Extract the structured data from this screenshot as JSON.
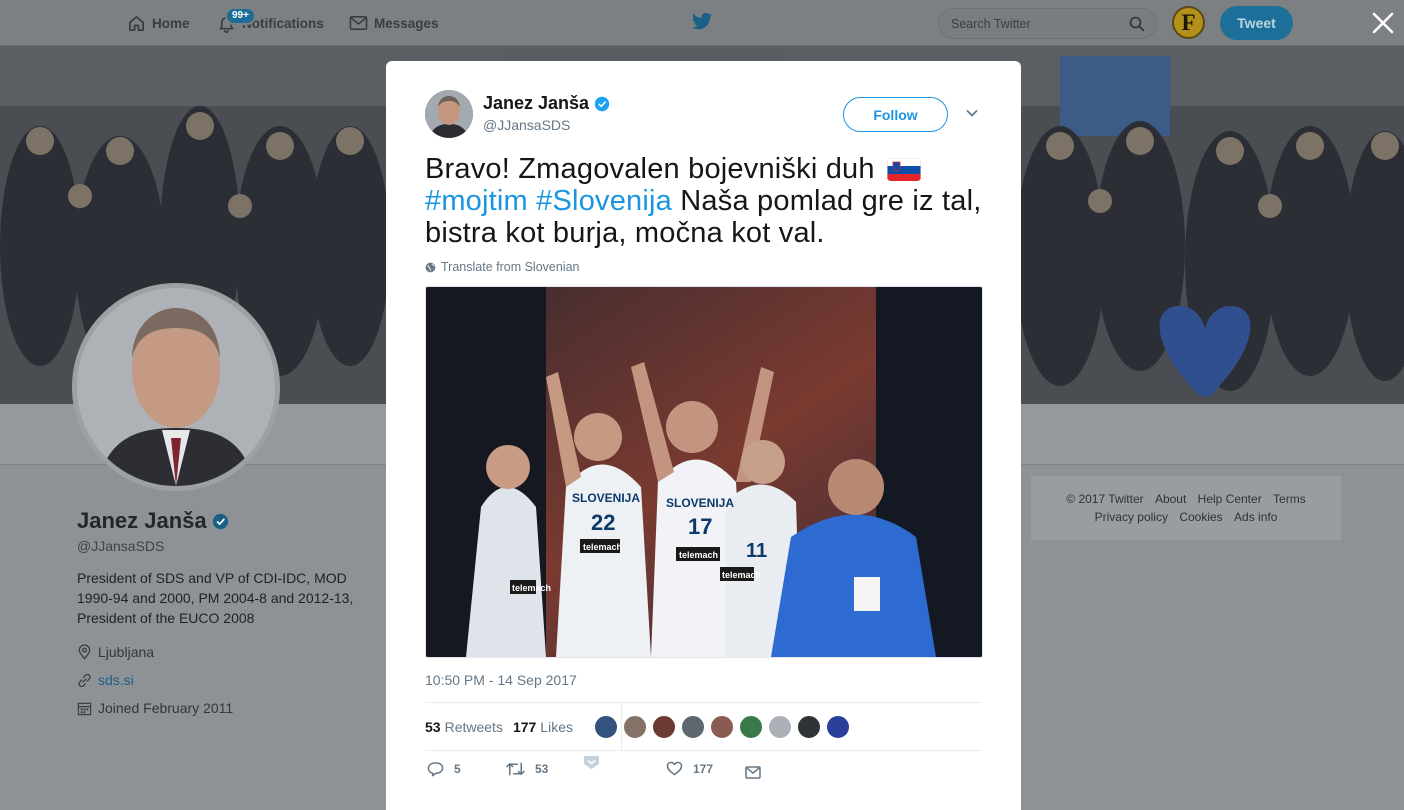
{
  "nav": {
    "home": "Home",
    "notifications": "Notifications",
    "notifications_badge": "99+",
    "messages": "Messages",
    "search_placeholder": "Search Twitter",
    "avatar_letter": "F",
    "tweet_button": "Tweet"
  },
  "profile": {
    "name": "Janez Janša",
    "handle": "@JJansaSDS",
    "bio": "President of SDS and VP of CDI-IDC, MOD 1990-94 and 2000, PM 2004-8 and 2012-13, President of the EUCO 2008",
    "location": "Ljubljana",
    "website": "sds.si",
    "joined": "Joined February 2011"
  },
  "footer": {
    "line1": [
      "© 2017 Twitter",
      "About",
      "Help Center",
      "Terms"
    ],
    "line2": [
      "Privacy policy",
      "Cookies",
      "Ads info"
    ]
  },
  "tweet": {
    "author_name": "Janez Janša",
    "author_handle": "@JJansaSDS",
    "follow_label": "Follow",
    "text_part1": "Bravo! Zmagovalen bojevniški duh",
    "hashtag1": "#mojtim",
    "hashtag2": "#Slovenija",
    "text_part2": "Naša pomlad gre iz tal, bistra kot burja, močna kot val.",
    "translate_label": "Translate from Slovenian",
    "timestamp": "10:50 PM - 14 Sep 2017",
    "retweets_count": "53",
    "retweets_label": "Retweets",
    "likes_count": "177",
    "likes_label": "Likes",
    "reply_count": "5",
    "retweet_count": "53",
    "like_count": "177",
    "photo_jerseys": [
      "SLOVENIJA",
      "22",
      "SLOVENIJA",
      "17",
      "11",
      "telemach",
      "telemach",
      "telemach",
      "telemach"
    ]
  },
  "colors": {
    "accent": "#1b95e0",
    "verified": "#1da1f2",
    "nav_overlay": "#7d8083",
    "page_overlay": "#8e9296"
  }
}
